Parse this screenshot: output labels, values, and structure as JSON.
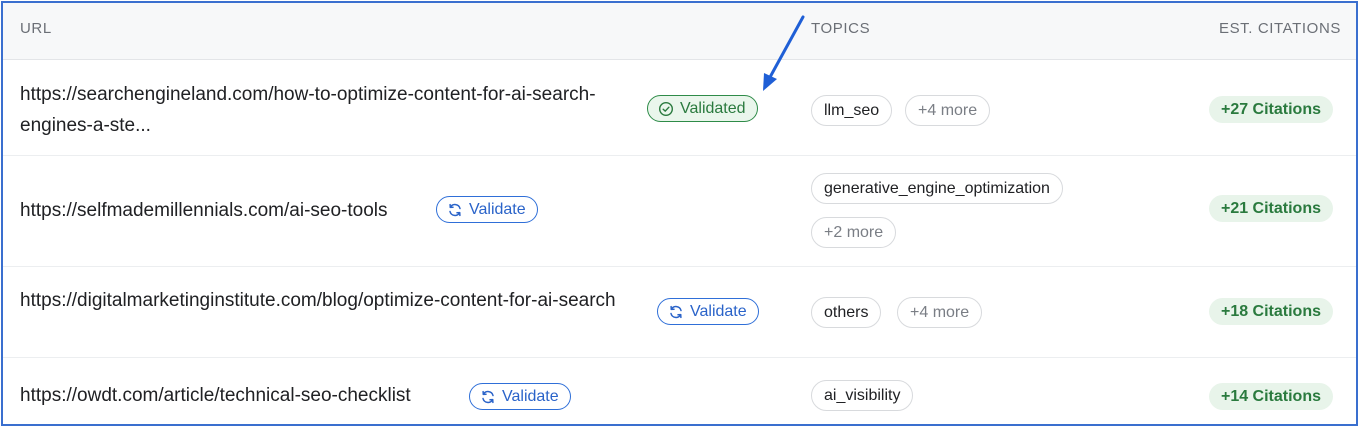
{
  "table": {
    "headers": {
      "url": "URL",
      "topics": "TOPICS",
      "citations": "EST. CITATIONS"
    },
    "rows": [
      {
        "url": "https://searchengineland.com/how-to-optimize-content-for-ai-search-engines-a-ste...",
        "status": "Validated",
        "status_icon": "check-circle-icon",
        "topics": [
          "llm_seo",
          "+4 more"
        ],
        "citations": "+27 Citations"
      },
      {
        "url": "https://selfmademillennials.com/ai-seo-tools",
        "status": "Validate",
        "status_icon": "refresh-icon",
        "topics": [
          "generative_engine_optimization",
          "+2 more"
        ],
        "citations": "+21 Citations"
      },
      {
        "url": "https://digitalmarketinginstitute.com/blog/optimize-content-for-ai-search",
        "status": "Validate",
        "status_icon": "refresh-icon",
        "topics": [
          "others",
          "+4 more"
        ],
        "citations": "+18 Citations"
      },
      {
        "url": "https://owdt.com/article/technical-seo-checklist",
        "status": "Validate",
        "status_icon": "refresh-icon",
        "topics": [
          "ai_visibility"
        ],
        "citations": "+14 Citations"
      }
    ]
  },
  "colors": {
    "frame_border": "#3a6fcf",
    "validated_green": "#2e8b48",
    "validate_blue": "#2f6fd8",
    "citation_bg": "#e8f4ea",
    "annotation_arrow": "#1f5fd6"
  },
  "annotation": {
    "icon": "annotation-arrow-icon",
    "points_to": "Validated"
  }
}
